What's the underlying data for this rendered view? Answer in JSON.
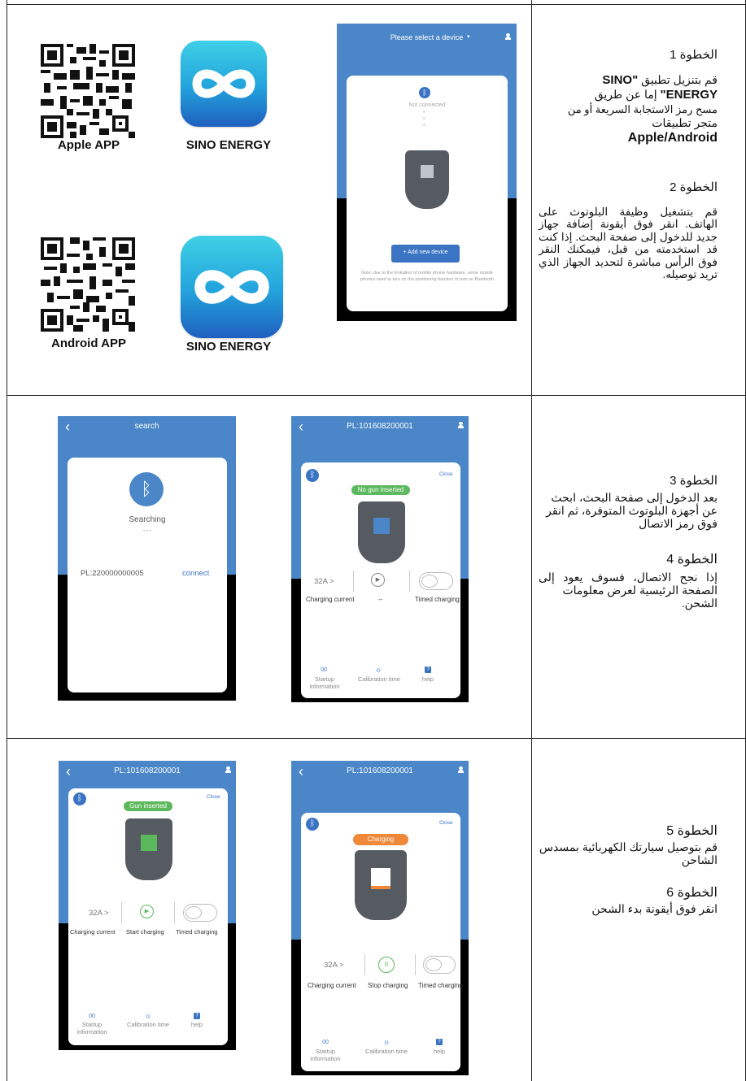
{
  "row1": {
    "qr_apple_caption": "Apple APP",
    "qr_android_caption": "Android APP",
    "app_name_1": "SINO ENERGY",
    "app_name_2": "SINO ENERGY",
    "phone": {
      "title": "Please select a device",
      "status": "Not connected",
      "add_button": "+ Add new device",
      "note": "Note: due to the limitation of mobile phone hardware, some mobile phones need to turn on the positioning function to turn on Bluetooth"
    },
    "step1_title": "الخطوة 1",
    "step1_l1_a": "قم بتنزيل تطبيق ",
    "step1_l1_b": "\"SINO",
    "step1_l2_a": "ENERGY\"",
    "step1_l2_b": " إما عن طريق",
    "step1_l3": "مسح رمز الاستجابة السريعة أو من",
    "step1_l4": "متجر تطبيقات",
    "step1_l5": "Apple/Android",
    "step2_title": "الخطوة 2",
    "step2_text": "قم بتشغيل وظيفة البلوتوث على الهاتف. انقر فوق أيقونة إضافة جهاز جديد للدخول إلى صفحة البحث. إذا كنت قد استخدمته من قبل، فيمكنك النقر فوق الرأس مباشرة لتحديد الجهاز الذي تريد توصيله."
  },
  "row2": {
    "search": {
      "title": "search",
      "searching": "Searching",
      "dots": "• • •",
      "device_id": "PL:220000000005",
      "connect": "connect"
    },
    "home": {
      "title": "PL:101608200001",
      "close": "Close",
      "badge": "No gun inserted",
      "current": "32A >",
      "dash": "--",
      "label_current": "Charging current",
      "label_timed": "Timed charging",
      "g1_icon": "00",
      "g1_label": "Startup information",
      "g2_icon": "⊙",
      "g2_label": "Calibration time",
      "g3_icon": "?",
      "g3_label": "help"
    },
    "step3_title": "الخطوة 3",
    "step3_text": "بعد الدخول إلى صفحة البحث، ابحث عن أجهزة البلوتوث المتوفرة، ثم انقر فوق رمز الاتصال",
    "step4_title": "الخطوة 4",
    "step4_text_a": "إذا نجح الاتصال، فسوف يعود إلى الصفحة الرئيسية لعرض معلومات",
    "step4_text_b": "الشحن."
  },
  "row3": {
    "left": {
      "title": "PL:101608200001",
      "close": "Close",
      "badge": "Gun inserted",
      "current": "32A >",
      "label_current": "Charging current",
      "label_action": "Start charging",
      "label_timed": "Timed charging",
      "g1_icon": "00",
      "g1_label": "Startup information",
      "g2_icon": "⊙",
      "g2_label": "Calibration time",
      "g3_icon": "?",
      "g3_label": "help"
    },
    "right": {
      "title": "PL:101608200001",
      "close": "Close",
      "badge": "Charging",
      "current": "32A >",
      "label_current": "Charging current",
      "label_action": "Stop charging",
      "label_timed": "Timed charging",
      "g1_icon": "00",
      "g1_label": "Startup information",
      "g2_icon": "⊙",
      "g2_label": "Calibration time",
      "g3_icon": "?",
      "g3_label": "help"
    },
    "step5_title": "الخطوة 5",
    "step5_text": "قم بتوصيل سيارتك الكهربائية بمسدس الشاحن",
    "step6_title": "الخطوة 6",
    "step6_text": "انقر فوق أيقونة بدء الشحن"
  }
}
